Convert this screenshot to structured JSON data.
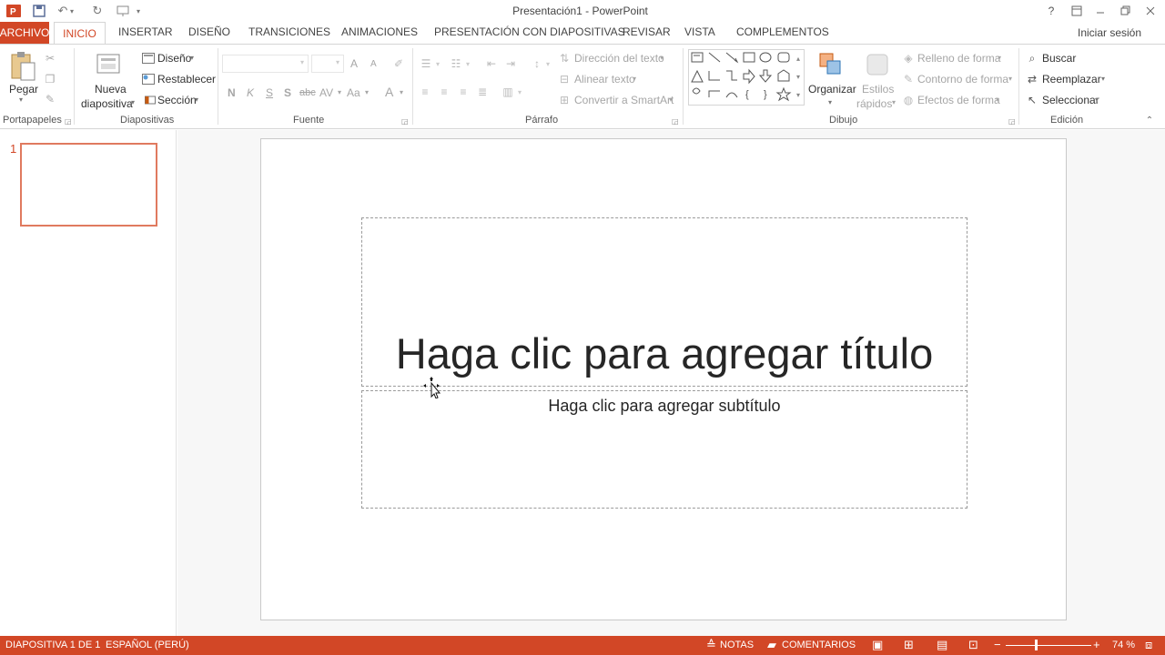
{
  "window": {
    "title": "Presentación1 - PowerPoint",
    "help": "?",
    "signin": "Iniciar sesión"
  },
  "tabs": [
    "ARCHIVO",
    "INICIO",
    "INSERTAR",
    "DISEÑO",
    "TRANSICIONES",
    "ANIMACIONES",
    "PRESENTACIÓN CON DIAPOSITIVAS",
    "REVISAR",
    "VISTA",
    "COMPLEMENTOS"
  ],
  "ribbon": {
    "portapapeles": {
      "label": "Portapapeles",
      "paste": "Pegar"
    },
    "diapositivas": {
      "label": "Diapositivas",
      "new_slide_1": "Nueva",
      "new_slide_2": "diapositiva",
      "layout": "Diseño",
      "reset": "Restablecer",
      "section": "Sección"
    },
    "fuente": {
      "label": "Fuente",
      "bold": "N",
      "italic": "K",
      "underline": "S",
      "shadow": "S",
      "strike": "abc",
      "spacing": "AV",
      "case": "Aa",
      "color": "A",
      "grow": "A",
      "shrink": "A"
    },
    "parrafo": {
      "label": "Párrafo",
      "text_direction": "Dirección del texto",
      "align_text": "Alinear texto",
      "smartart": "Convertir a SmartArt"
    },
    "dibujo": {
      "label": "Dibujo",
      "arrange": "Organizar",
      "quick_styles_1": "Estilos",
      "quick_styles_2": "rápidos",
      "fill": "Relleno de forma",
      "outline": "Contorno de forma",
      "effects": "Efectos de forma"
    },
    "edicion": {
      "label": "Edición",
      "find": "Buscar",
      "replace": "Reemplazar",
      "select": "Seleccionar"
    }
  },
  "thumbnails": {
    "number": "1"
  },
  "slide": {
    "title_placeholder": "Haga clic para agregar título",
    "subtitle_placeholder": "Haga clic para agregar subtítulo"
  },
  "status": {
    "slide_count": "DIAPOSITIVA 1 DE 1",
    "language": "ESPAÑOL (PERÚ)",
    "notes": "NOTAS",
    "comments": "COMENTARIOS",
    "zoom_minus": "−",
    "zoom_plus": "+",
    "zoom": "74 %"
  },
  "colors": {
    "accent": "#d24726",
    "thumb_border": "#e07a5f"
  }
}
